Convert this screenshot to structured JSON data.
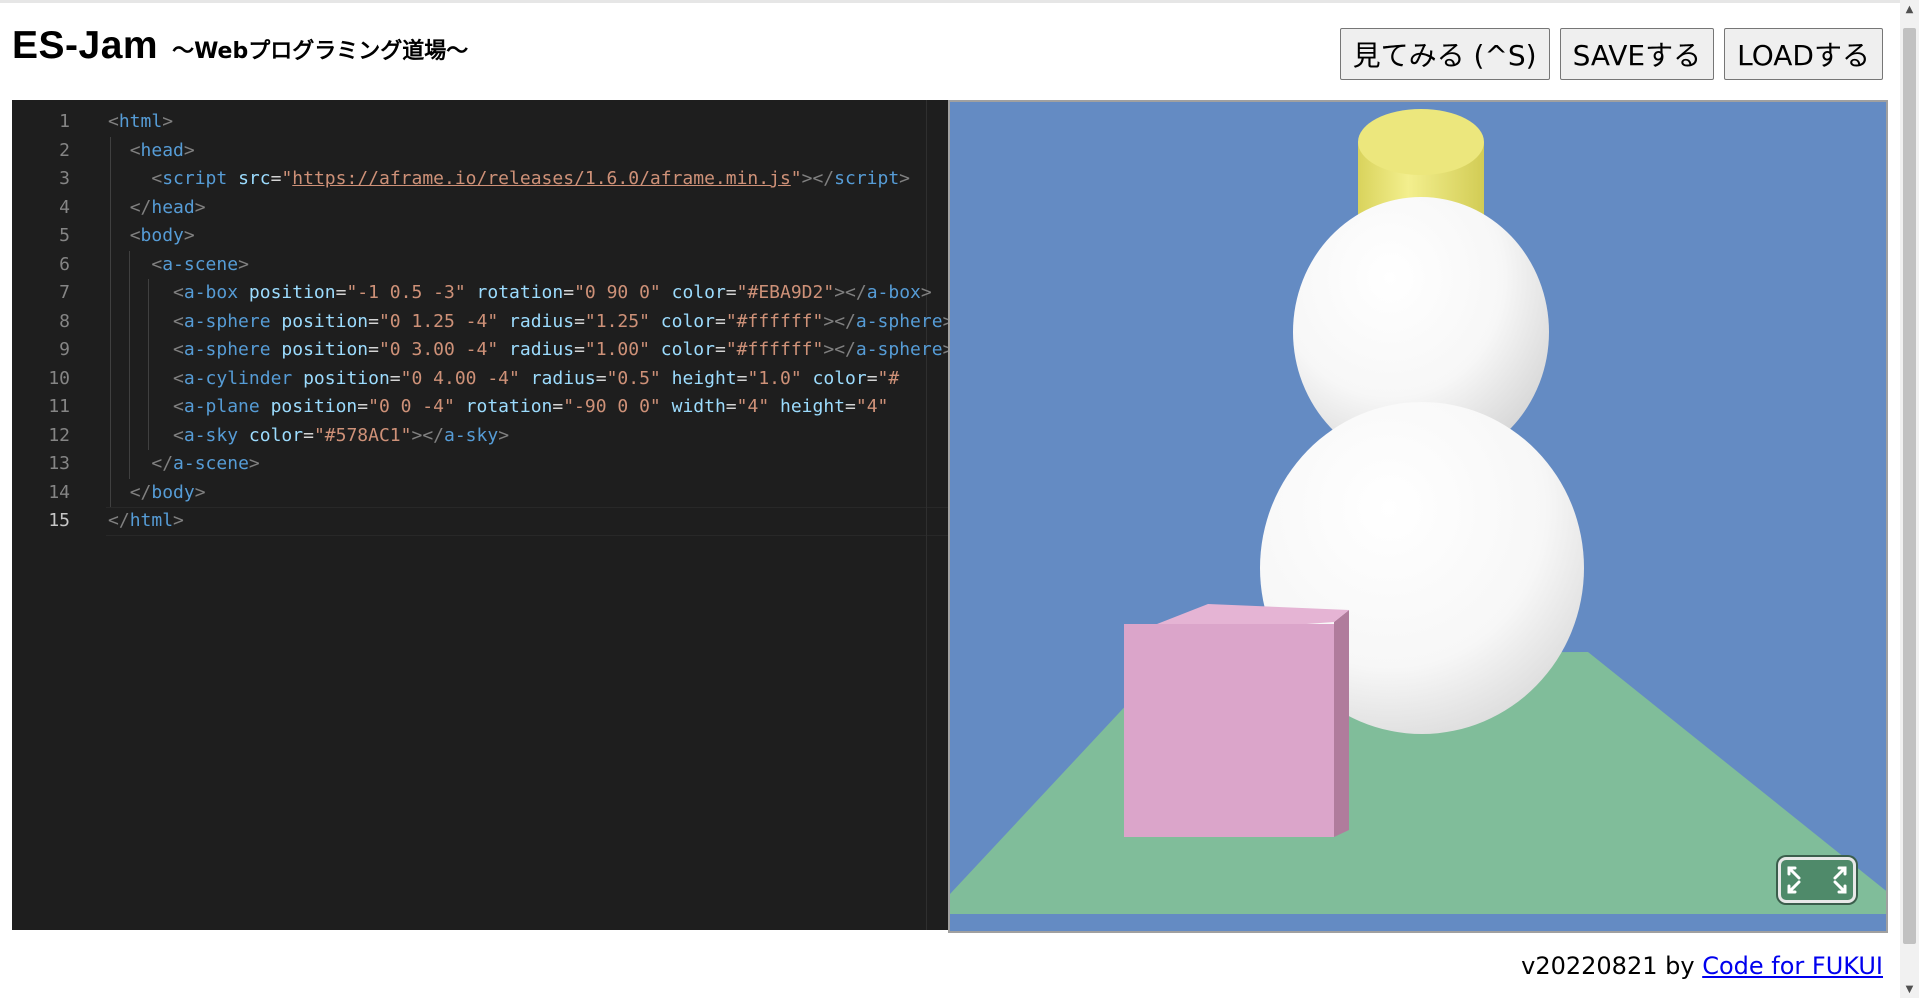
{
  "header": {
    "title": "ES-Jam",
    "subtitle": "～Webプログラミング道場～"
  },
  "toolbar": {
    "view_label": "見てみる (^S)",
    "save_label": "SAVEする",
    "load_label": "LOADする"
  },
  "editor": {
    "active_line": 15,
    "lines": [
      [
        [
          "br",
          "<"
        ],
        [
          "tag",
          "html"
        ],
        [
          "br",
          ">"
        ]
      ],
      [
        [
          "sp",
          "  "
        ],
        [
          "br",
          "<"
        ],
        [
          "tag",
          "head"
        ],
        [
          "br",
          ">"
        ]
      ],
      [
        [
          "sp",
          "    "
        ],
        [
          "br",
          "<"
        ],
        [
          "tag",
          "script"
        ],
        [
          "sp",
          " "
        ],
        [
          "attr",
          "src"
        ],
        [
          "eq",
          "="
        ],
        [
          "str",
          "\""
        ],
        [
          "url",
          "https://aframe.io/releases/1.6.0/aframe.min.js"
        ],
        [
          "str",
          "\""
        ],
        [
          "br",
          "></"
        ],
        [
          "tag",
          "script"
        ],
        [
          "br",
          ">"
        ]
      ],
      [
        [
          "sp",
          "  "
        ],
        [
          "br",
          "</"
        ],
        [
          "tag",
          "head"
        ],
        [
          "br",
          ">"
        ]
      ],
      [
        [
          "sp",
          "  "
        ],
        [
          "br",
          "<"
        ],
        [
          "tag",
          "body"
        ],
        [
          "br",
          ">"
        ]
      ],
      [
        [
          "sp",
          "    "
        ],
        [
          "br",
          "<"
        ],
        [
          "tag",
          "a-scene"
        ],
        [
          "br",
          ">"
        ]
      ],
      [
        [
          "sp",
          "      "
        ],
        [
          "br",
          "<"
        ],
        [
          "tag",
          "a-box"
        ],
        [
          "sp",
          " "
        ],
        [
          "attr",
          "position"
        ],
        [
          "eq",
          "="
        ],
        [
          "str",
          "\"-1 0.5 -3\""
        ],
        [
          "sp",
          " "
        ],
        [
          "attr",
          "rotation"
        ],
        [
          "eq",
          "="
        ],
        [
          "str",
          "\"0 90 0\""
        ],
        [
          "sp",
          " "
        ],
        [
          "attr",
          "color"
        ],
        [
          "eq",
          "="
        ],
        [
          "str",
          "\"#EBA9D2\""
        ],
        [
          "br",
          "></"
        ],
        [
          "tag",
          "a-box"
        ],
        [
          "br",
          ">"
        ]
      ],
      [
        [
          "sp",
          "      "
        ],
        [
          "br",
          "<"
        ],
        [
          "tag",
          "a-sphere"
        ],
        [
          "sp",
          " "
        ],
        [
          "attr",
          "position"
        ],
        [
          "eq",
          "="
        ],
        [
          "str",
          "\"0 1.25 -4\""
        ],
        [
          "sp",
          " "
        ],
        [
          "attr",
          "radius"
        ],
        [
          "eq",
          "="
        ],
        [
          "str",
          "\"1.25\""
        ],
        [
          "sp",
          " "
        ],
        [
          "attr",
          "color"
        ],
        [
          "eq",
          "="
        ],
        [
          "str",
          "\"#ffffff\""
        ],
        [
          "br",
          "></"
        ],
        [
          "tag",
          "a-sphere"
        ],
        [
          "br",
          ">"
        ]
      ],
      [
        [
          "sp",
          "      "
        ],
        [
          "br",
          "<"
        ],
        [
          "tag",
          "a-sphere"
        ],
        [
          "sp",
          " "
        ],
        [
          "attr",
          "position"
        ],
        [
          "eq",
          "="
        ],
        [
          "str",
          "\"0 3.00 -4\""
        ],
        [
          "sp",
          " "
        ],
        [
          "attr",
          "radius"
        ],
        [
          "eq",
          "="
        ],
        [
          "str",
          "\"1.00\""
        ],
        [
          "sp",
          " "
        ],
        [
          "attr",
          "color"
        ],
        [
          "eq",
          "="
        ],
        [
          "str",
          "\"#ffffff\""
        ],
        [
          "br",
          "></"
        ],
        [
          "tag",
          "a-sphere"
        ],
        [
          "br",
          ">"
        ]
      ],
      [
        [
          "sp",
          "      "
        ],
        [
          "br",
          "<"
        ],
        [
          "tag",
          "a-cylinder"
        ],
        [
          "sp",
          " "
        ],
        [
          "attr",
          "position"
        ],
        [
          "eq",
          "="
        ],
        [
          "str",
          "\"0 4.00 -4\""
        ],
        [
          "sp",
          " "
        ],
        [
          "attr",
          "radius"
        ],
        [
          "eq",
          "="
        ],
        [
          "str",
          "\"0.5\""
        ],
        [
          "sp",
          " "
        ],
        [
          "attr",
          "height"
        ],
        [
          "eq",
          "="
        ],
        [
          "str",
          "\"1.0\""
        ],
        [
          "sp",
          " "
        ],
        [
          "attr",
          "color"
        ],
        [
          "eq",
          "="
        ],
        [
          "str",
          "\"#"
        ]
      ],
      [
        [
          "sp",
          "      "
        ],
        [
          "br",
          "<"
        ],
        [
          "tag",
          "a-plane"
        ],
        [
          "sp",
          " "
        ],
        [
          "attr",
          "position"
        ],
        [
          "eq",
          "="
        ],
        [
          "str",
          "\"0 0 -4\""
        ],
        [
          "sp",
          " "
        ],
        [
          "attr",
          "rotation"
        ],
        [
          "eq",
          "="
        ],
        [
          "str",
          "\"-90 0 0\""
        ],
        [
          "sp",
          " "
        ],
        [
          "attr",
          "width"
        ],
        [
          "eq",
          "="
        ],
        [
          "str",
          "\"4\""
        ],
        [
          "sp",
          " "
        ],
        [
          "attr",
          "height"
        ],
        [
          "eq",
          "="
        ],
        [
          "str",
          "\"4\""
        ]
      ],
      [
        [
          "sp",
          "      "
        ],
        [
          "br",
          "<"
        ],
        [
          "tag",
          "a-sky"
        ],
        [
          "sp",
          " "
        ],
        [
          "attr",
          "color"
        ],
        [
          "eq",
          "="
        ],
        [
          "str",
          "\"#578AC1\""
        ],
        [
          "br",
          "></"
        ],
        [
          "tag",
          "a-sky"
        ],
        [
          "br",
          ">"
        ]
      ],
      [
        [
          "sp",
          "    "
        ],
        [
          "br",
          "</"
        ],
        [
          "tag",
          "a-scene"
        ],
        [
          "br",
          ">"
        ]
      ],
      [
        [
          "sp",
          "  "
        ],
        [
          "br",
          "</"
        ],
        [
          "tag",
          "body"
        ],
        [
          "br",
          ">"
        ]
      ],
      [
        [
          "br",
          "</"
        ],
        [
          "tag",
          "html"
        ],
        [
          "br",
          ">"
        ]
      ]
    ]
  },
  "preview": {
    "sky_color": "#648bc3",
    "plane_color": "#80bd9a",
    "box_color": "#dba5ca",
    "box_side_color": "#b07c9c",
    "cylinder_color": "#e6e271",
    "snow_color": "#ffffff",
    "fullscreen_icon": "fullscreen-icon"
  },
  "footer": {
    "version": "v20220821",
    "by": " by ",
    "link_label": "Code for FUKUI"
  }
}
